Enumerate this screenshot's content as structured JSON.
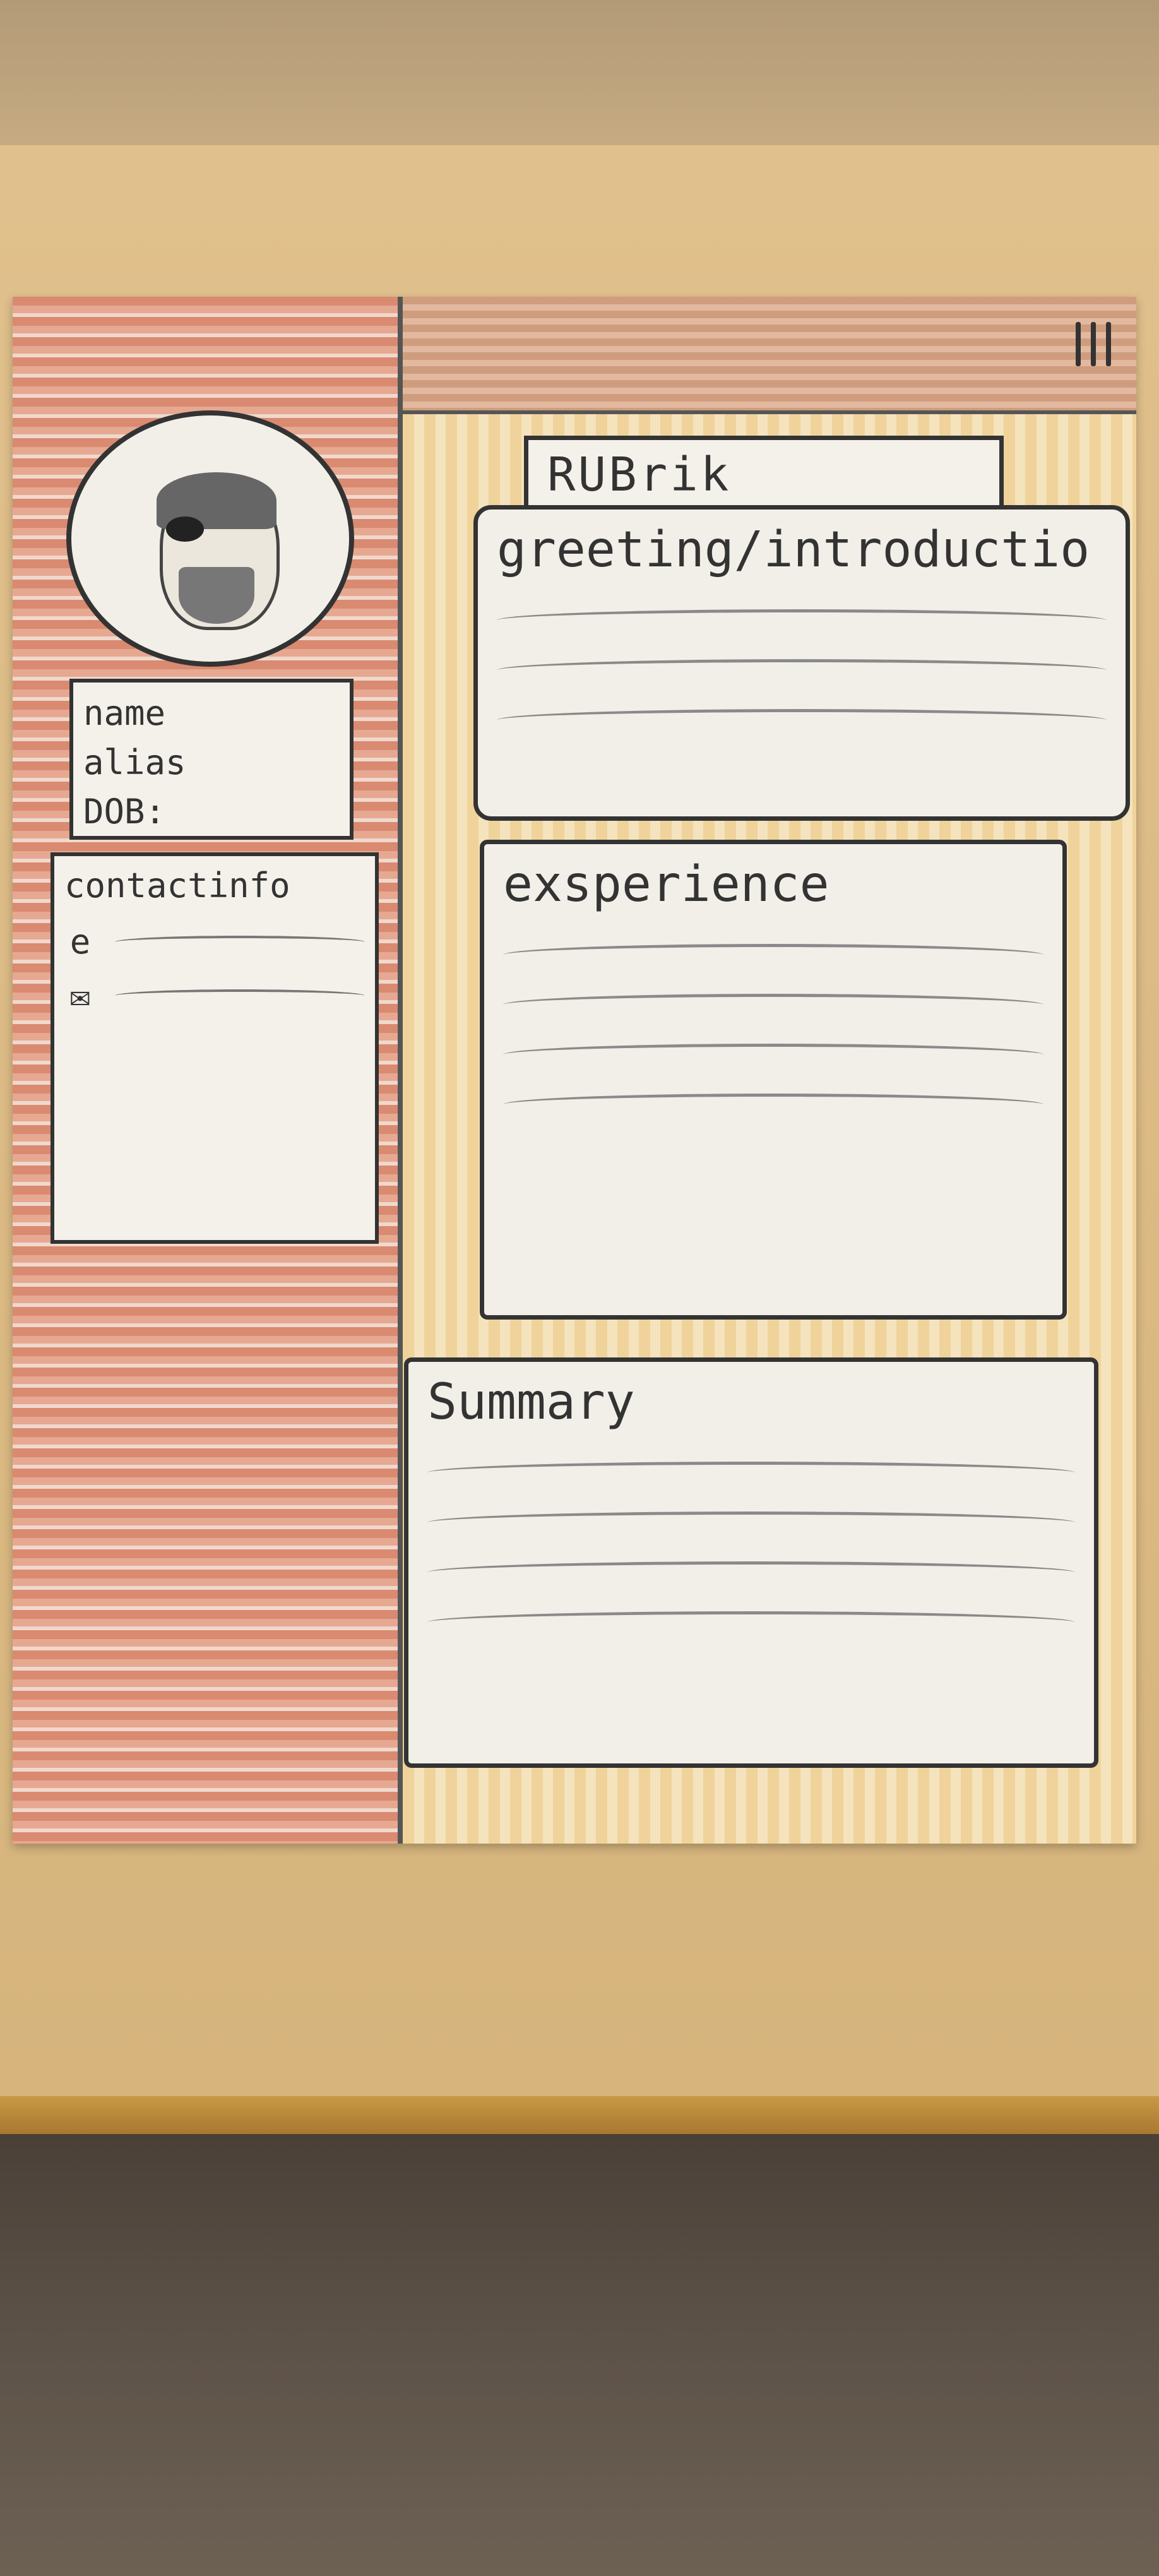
{
  "header": {
    "menu_icon": "hamburger-menu-icon"
  },
  "sidebar": {
    "avatar_icon": "avatar-icon",
    "profile": {
      "name_label": "name",
      "alias_label": "alias",
      "dob_label": "DOB:"
    },
    "contact": {
      "title": "contactinfo",
      "rows": [
        {
          "icon": "e",
          "icon_name": "email-icon"
        },
        {
          "icon": "✉",
          "icon_name": "mail-icon"
        }
      ]
    }
  },
  "main": {
    "rubrik_label": "RUBrik",
    "sections": [
      {
        "title": "greeting/introductio"
      },
      {
        "title": "exsperience"
      },
      {
        "title": "Summary"
      }
    ]
  }
}
